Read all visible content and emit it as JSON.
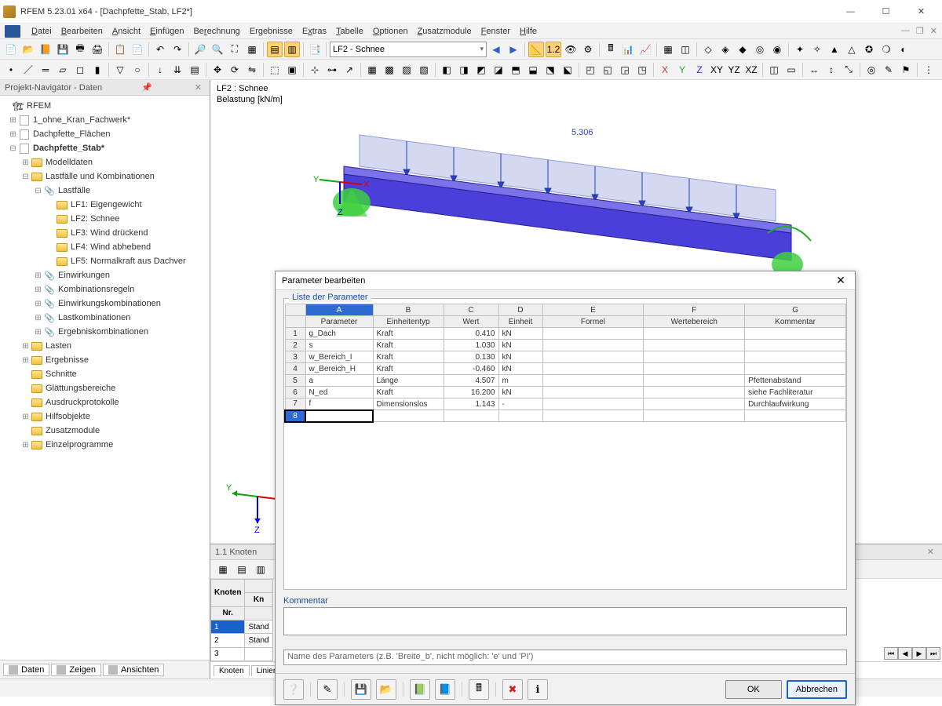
{
  "window": {
    "title": "RFEM 5.23.01 x64 - [Dachpfette_Stab, LF2*]"
  },
  "menu": {
    "items": [
      "Datei",
      "Bearbeiten",
      "Ansicht",
      "Einfügen",
      "Berechnung",
      "Ergebnisse",
      "Extras",
      "Tabelle",
      "Optionen",
      "Zusatzmodule",
      "Fenster",
      "Hilfe"
    ]
  },
  "toolbar1": {
    "dropdown_value": "LF2 - Schnee"
  },
  "navigator": {
    "title": "Projekt-Navigator - Daten",
    "root": "RFEM",
    "models": [
      "1_ohne_Kran_Fachwerk*",
      "Dachpfette_Flächen",
      "Dachpfette_Stab*"
    ],
    "modeltree": {
      "Modelldaten": [],
      "Lastfälle und Kombinationen": {
        "Lastfälle": [
          "LF1: Eigengewicht",
          "LF2: Schnee",
          "LF3: Wind drückend",
          "LF4: Wind abhebend",
          "LF5: Normalkraft aus Dachver"
        ],
        "other": [
          "Einwirkungen",
          "Kombinationsregeln",
          "Einwirkungskombinationen",
          "Lastkombinationen",
          "Ergebniskombinationen"
        ]
      },
      "rest": [
        "Lasten",
        "Ergebnisse",
        "Schnitte",
        "Glättungsbereiche",
        "Ausdruckprotokolle",
        "Hilfsobjekte",
        "Zusatzmodule",
        "Einzelprogramme"
      ]
    },
    "tabs": [
      "Daten",
      "Zeigen",
      "Ansichten"
    ]
  },
  "viewport": {
    "line1": "LF2 : Schnee",
    "line2": "Belastung [kN/m]",
    "load_label": "5.306",
    "axis": {
      "x": "X",
      "y": "Y",
      "z": "Z"
    }
  },
  "knoten": {
    "title": "1.1 Knoten",
    "header1": "Knoten",
    "header2": "Nr.",
    "header3": "Kn",
    "rows": [
      {
        "n": "1",
        "v": "Stand"
      },
      {
        "n": "2",
        "v": "Stand"
      },
      {
        "n": "3",
        "v": ""
      }
    ],
    "tabs": [
      "Knoten",
      "Linien"
    ]
  },
  "dialog": {
    "title": "Parameter bearbeiten",
    "grouplabel": "Liste der Parameter",
    "cols": [
      "A",
      "B",
      "C",
      "D",
      "E",
      "F",
      "G"
    ],
    "colheads": [
      "Parameter",
      "Einheitentyp",
      "Wert",
      "Einheit",
      "Formel",
      "Wertebereich",
      "Kommentar"
    ],
    "rows": [
      {
        "n": 1,
        "p": "g_Dach",
        "e": "Kraft",
        "w": "0.410",
        "u": "kN",
        "f": "",
        "wb": "",
        "k": ""
      },
      {
        "n": 2,
        "p": "s",
        "e": "Kraft",
        "w": "1.030",
        "u": "kN",
        "f": "",
        "wb": "",
        "k": ""
      },
      {
        "n": 3,
        "p": "w_Bereich_I",
        "e": "Kraft",
        "w": "0.130",
        "u": "kN",
        "f": "",
        "wb": "",
        "k": ""
      },
      {
        "n": 4,
        "p": "w_Bereich_H",
        "e": "Kraft",
        "w": "-0.460",
        "u": "kN",
        "f": "",
        "wb": "",
        "k": ""
      },
      {
        "n": 5,
        "p": "a",
        "e": "Länge",
        "w": "4.507",
        "u": "m",
        "f": "",
        "wb": "",
        "k": "Pfettenabstand"
      },
      {
        "n": 6,
        "p": "N_ed",
        "e": "Kraft",
        "w": "16.200",
        "u": "kN",
        "f": "",
        "wb": "",
        "k": "siehe Fachliteratur"
      },
      {
        "n": 7,
        "p": "f",
        "e": "Dimensionslos",
        "w": "1.143",
        "u": "-",
        "f": "",
        "wb": "",
        "k": "Durchlaufwirkung"
      }
    ],
    "emptyrow": 8,
    "kommentar_label": "Kommentar",
    "hint": "Name des Parameters (z.B. 'Breite_b', nicht möglich: 'e' und 'PI')",
    "ok": "OK",
    "cancel": "Abbrechen"
  }
}
